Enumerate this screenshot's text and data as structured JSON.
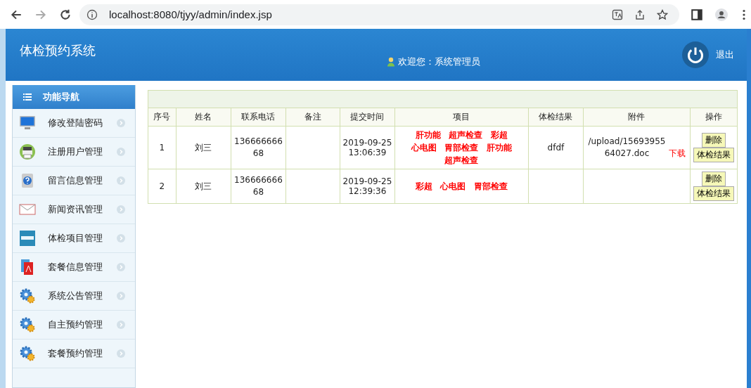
{
  "browser": {
    "url": "localhost:8080/tjyy/admin/index.jsp"
  },
  "header": {
    "title": "体检预约系统",
    "welcome": "欢迎您：系统管理员",
    "logout": "退出"
  },
  "sidebar": {
    "heading": "功能导航",
    "items": [
      {
        "label": "修改登陆密码",
        "kind": "monitor"
      },
      {
        "label": "注册用户管理",
        "kind": "printer"
      },
      {
        "label": "留言信息管理",
        "kind": "help"
      },
      {
        "label": "新闻资讯管理",
        "kind": "mail"
      },
      {
        "label": "体检项目管理",
        "kind": "news"
      },
      {
        "label": "套餐信息管理",
        "kind": "pdf"
      },
      {
        "label": "系统公告管理",
        "kind": "gear"
      },
      {
        "label": "自主预约管理",
        "kind": "gear"
      },
      {
        "label": "套餐预约管理",
        "kind": "gear"
      }
    ]
  },
  "table": {
    "columns": [
      "序号",
      "姓名",
      "联系电话",
      "备注",
      "提交时间",
      "项目",
      "体检结果",
      "附件",
      "操作"
    ],
    "rows": [
      {
        "no": "1",
        "name": "刘三",
        "phone": "13666666668",
        "time": "2019-09-25 13:06:39",
        "items": [
          "肝功能",
          "超声检查",
          "彩超",
          "心电图",
          "胃部检查",
          "肝功能",
          "超声检查"
        ],
        "result": "dfdf",
        "attachment": "/upload/1569395564027.doc",
        "download": "下载",
        "buttons": [
          "删除",
          "体检结果"
        ]
      },
      {
        "no": "2",
        "name": "刘三",
        "phone": "13666666668",
        "time": "2019-09-25 12:39:36",
        "items": [
          "彩超",
          "心电图",
          "胃部检查"
        ],
        "buttons": [
          "删除",
          "体检结果"
        ]
      }
    ]
  }
}
